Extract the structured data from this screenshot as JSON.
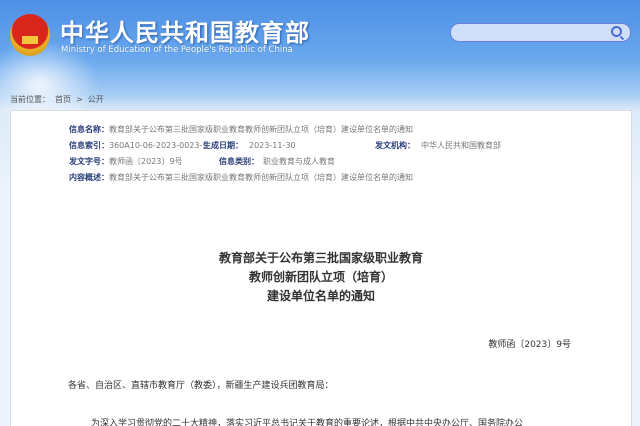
{
  "header": {
    "title_cn": "中华人民共和国教育部",
    "title_en": "Ministry of Education of the People's Republic of China",
    "search_placeholder": ""
  },
  "breadcrumb": {
    "label": "当前位置：",
    "home": "首页",
    "sep": ">",
    "current": "公开"
  },
  "meta": {
    "name_label": "信息名称：",
    "name_value": "教育部关于公布第三批国家级职业教育教师创新团队立项（培育）建设单位名单的通知",
    "index_label": "信息索引：",
    "index_value": "360A10-06-2023-0023-1",
    "date_label": "生成日期：",
    "date_value": "2023-11-30",
    "org_label": "发文机构：",
    "org_value": "中华人民共和国教育部",
    "docno_label": "发文字号：",
    "docno_value": "教师函〔2023〕9号",
    "category_label": "信息类别：",
    "category_value": "职业教育与成人教育",
    "summary_label": "内容概述：",
    "summary_value": "教育部关于公布第三批国家级职业教育教师创新团队立项（培育）建设单位名单的通知"
  },
  "doc": {
    "title_lines": [
      "教育部关于公布第三批国家级职业教育",
      "教师创新团队立项（培育）",
      "建设单位名单的通知"
    ],
    "number": "教师函〔2023〕9号",
    "addressee": "各省、自治区、直辖市教育厅（教委），新疆生产建设兵团教育局：",
    "para1": "为深入学习贯彻党的二十大精神，落实习近平总书记关于教育的重要论述，根据中共中央办公厅、国务院办公"
  }
}
